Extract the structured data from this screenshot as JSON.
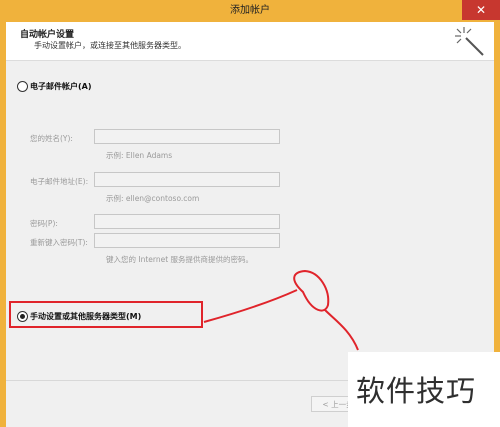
{
  "window": {
    "title": "添加帐户",
    "close_glyph": "✕"
  },
  "header": {
    "title": "自动帐户设置",
    "subtitle": "手动设置帐户，或连接至其他服务器类型。",
    "icon": "magic-wand-icon"
  },
  "options": {
    "email_account_label": "电子邮件帐户(A)",
    "email_account_checked": false,
    "manual_setup_label": "手动设置或其他服务器类型(M)",
    "manual_setup_checked": true
  },
  "form": {
    "name_label": "您的姓名(Y):",
    "name_value": "",
    "name_hint": "示例: Ellen Adams",
    "email_label": "电子邮件地址(E):",
    "email_value": "",
    "email_hint": "示例: ellen@contoso.com",
    "password_label": "密码(P):",
    "password_value": "",
    "retype_label": "重新键入密码(T):",
    "retype_value": "",
    "password_hint": "键入您的 Internet 服务提供商提供的密码。"
  },
  "footer": {
    "prev_label": "< 上一步"
  },
  "watermark": {
    "text": "软件技巧"
  },
  "colors": {
    "title_bar": "#f0b23c",
    "close": "#c7372f",
    "annotation": "#e0242b"
  }
}
